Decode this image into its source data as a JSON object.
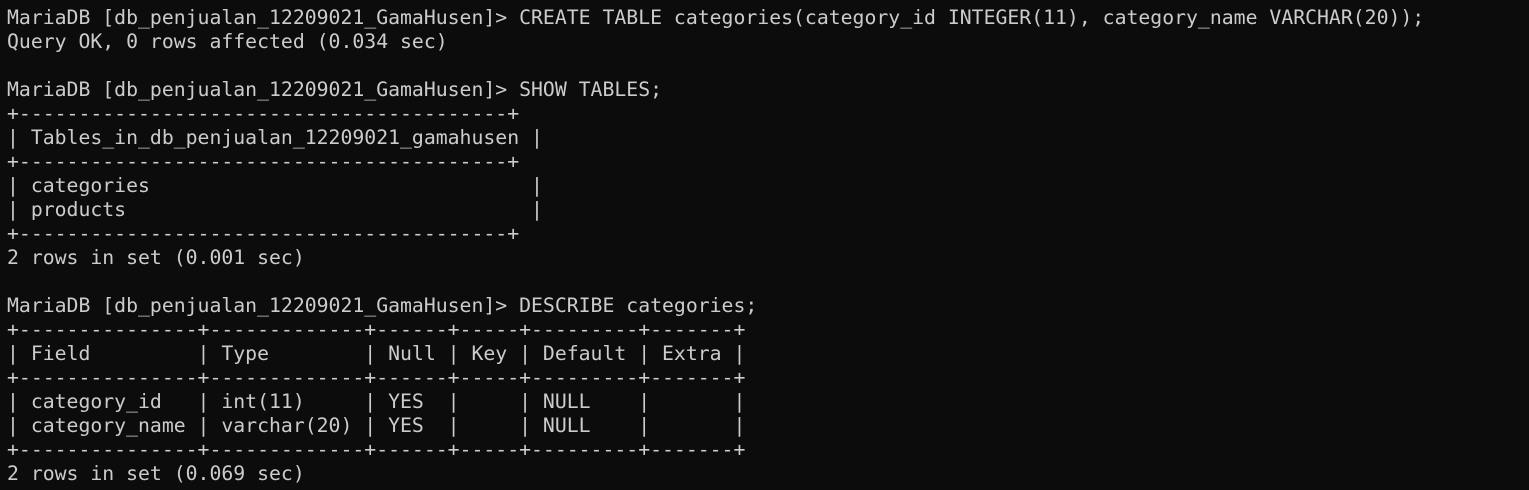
{
  "terminal": {
    "lines": [
      "MariaDB [db_penjualan_12209021_GamaHusen]> CREATE TABLE categories(category_id INTEGER(11), category_name VARCHAR(20));",
      "Query OK, 0 rows affected (0.034 sec)",
      "",
      "MariaDB [db_penjualan_12209021_GamaHusen]> SHOW TABLES;",
      "+-----------------------------------------+",
      "| Tables_in_db_penjualan_12209021_gamahusen |",
      "+-----------------------------------------+",
      "| categories                                |",
      "| products                                  |",
      "+-----------------------------------------+",
      "2 rows in set (0.001 sec)",
      "",
      "MariaDB [db_penjualan_12209021_GamaHusen]> DESCRIBE categories;",
      "+---------------+-------------+------+-----+---------+-------+",
      "| Field         | Type        | Null | Key | Default | Extra |",
      "+---------------+-------------+------+-----+---------+-------+",
      "| category_id   | int(11)     | YES  |     | NULL    |       |",
      "| category_name | varchar(20) | YES  |     | NULL    |       |",
      "+---------------+-------------+------+-----+---------+-------+",
      "2 rows in set (0.069 sec)"
    ]
  },
  "colors": {
    "background": "#0c0c0c",
    "foreground": "#cccccc"
  }
}
